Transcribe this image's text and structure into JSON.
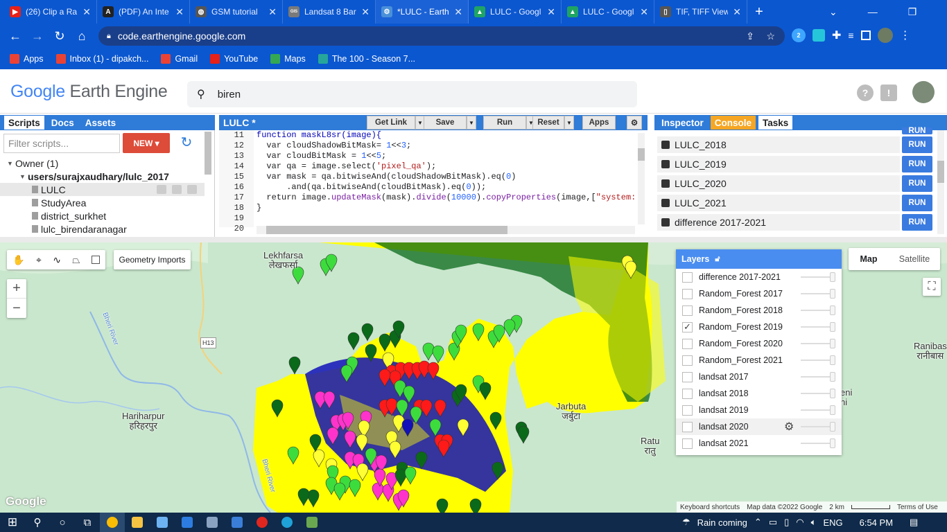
{
  "browser": {
    "tabs": [
      {
        "label": "(26) Clip a Ra",
        "color": "#e62117",
        "glyph": "▶"
      },
      {
        "label": "(PDF) An Inte",
        "color": "#222222",
        "glyph": "A"
      },
      {
        "label": "GSM tutorial",
        "color": "#555555",
        "glyph": "◍"
      },
      {
        "label": "Landsat 8 Bar",
        "color": "#7a7a7a",
        "glyph": "GIS"
      },
      {
        "label": "*LULC - Earth",
        "color": "#4a90d9",
        "glyph": "⚙",
        "active": true
      },
      {
        "label": "LULC - Googl",
        "color": "#1fa463",
        "glyph": "▲"
      },
      {
        "label": "LULC - Googl",
        "color": "#1fa463",
        "glyph": "▲"
      },
      {
        "label": "TIF, TIFF View",
        "color": "#555555",
        "glyph": "▯"
      }
    ],
    "url": "code.earthengine.google.com",
    "bookmarks": [
      {
        "label": "Apps",
        "color": "#ea4335"
      },
      {
        "label": "Inbox (1) - dipakch...",
        "color": "#ea4335"
      },
      {
        "label": "Gmail",
        "color": "#ea4335"
      },
      {
        "label": "YouTube",
        "color": "#e62117"
      },
      {
        "label": "Maps",
        "color": "#34a853"
      },
      {
        "label": "The 100 - Season 7...",
        "color": "#26a69a"
      }
    ],
    "ext_badge": "2"
  },
  "header": {
    "logo_google": "Google",
    "logo_product": "Earth Engine",
    "search_value": "biren"
  },
  "left_panel": {
    "tabs": [
      "Scripts",
      "Docs",
      "Assets"
    ],
    "filter_placeholder": "Filter scripts...",
    "new_label": "NEW",
    "owner_label": "Owner (1)",
    "repo": "users/surajxaudhary/lulc_2017",
    "files": [
      "LULC",
      "StudyArea",
      "district_surkhet",
      "lulc_birendaranagar"
    ]
  },
  "editor": {
    "title": "LULC *",
    "buttons": {
      "get_link": "Get Link",
      "save": "Save",
      "run": "Run",
      "reset": "Reset",
      "apps": "Apps"
    },
    "line_numbers": [
      "11",
      "12",
      "13",
      "14",
      "15",
      "16",
      "17",
      "18",
      "19",
      "20"
    ],
    "lines": [
      [
        {
          "t": "function maskL8sr(image){",
          "c": "kw"
        }
      ],
      [
        {
          "t": "  var cloudShadowBitMask= ",
          "c": ""
        },
        {
          "t": "1",
          "c": "num"
        },
        {
          "t": "<<",
          "c": ""
        },
        {
          "t": "3",
          "c": "num"
        },
        {
          "t": ";",
          "c": ""
        }
      ],
      [
        {
          "t": "  var cloudBitMask = ",
          "c": ""
        },
        {
          "t": "1",
          "c": "num"
        },
        {
          "t": "<<",
          "c": ""
        },
        {
          "t": "5",
          "c": "num"
        },
        {
          "t": ";",
          "c": ""
        }
      ],
      [
        {
          "t": "  var qa = image.select(",
          "c": ""
        },
        {
          "t": "'pixel_qa'",
          "c": "str"
        },
        {
          "t": ");",
          "c": ""
        }
      ],
      [
        {
          "t": "  var mask = qa.bitwiseAnd(cloudShadowBitMask).eq(",
          "c": ""
        },
        {
          "t": "0",
          "c": "num"
        },
        {
          "t": ")",
          "c": ""
        }
      ],
      [
        {
          "t": "      .and(qa.bitwiseAnd(cloudBitMask).eq(",
          "c": ""
        },
        {
          "t": "0",
          "c": "num"
        },
        {
          "t": "));",
          "c": ""
        }
      ],
      [
        {
          "t": "  return image.",
          "c": ""
        },
        {
          "t": "updateMask",
          "c": "fn"
        },
        {
          "t": "(mask).",
          "c": ""
        },
        {
          "t": "divide",
          "c": "fn"
        },
        {
          "t": "(",
          "c": ""
        },
        {
          "t": "10000",
          "c": "num"
        },
        {
          "t": ").",
          "c": ""
        },
        {
          "t": "copyProperties",
          "c": "fn"
        },
        {
          "t": "(image,[",
          "c": ""
        },
        {
          "t": "\"system:t",
          "c": "str"
        }
      ],
      [
        {
          "t": "}",
          "c": ""
        }
      ],
      [
        {
          "t": "",
          "c": ""
        }
      ],
      [
        {
          "t": "",
          "c": ""
        }
      ]
    ]
  },
  "right_panel": {
    "tabs": [
      "Inspector",
      "Console",
      "Tasks"
    ],
    "tasks": [
      "LULC_2018",
      "LULC_2019",
      "LULC_2020",
      "LULC_2021",
      "difference 2017-2021"
    ],
    "run_label": "RUN"
  },
  "map": {
    "geometry_imports": "Geometry Imports",
    "zoom_in": "+",
    "zoom_out": "−",
    "map_type": [
      "Map",
      "Satellite"
    ],
    "layers_title": "Layers",
    "layers": [
      {
        "name": "difference 2017-2021",
        "checked": false
      },
      {
        "name": "Random_Forest 2017",
        "checked": false
      },
      {
        "name": "Random_Forest 2018",
        "checked": false
      },
      {
        "name": "Random_Forest 2019",
        "checked": true
      },
      {
        "name": "Random_Forest 2020",
        "checked": false
      },
      {
        "name": "Random_Forest 2021",
        "checked": false
      },
      {
        "name": "landsat 2017",
        "checked": false
      },
      {
        "name": "landsat 2018",
        "checked": false
      },
      {
        "name": "landsat 2019",
        "checked": false
      },
      {
        "name": "landsat 2020",
        "checked": false
      },
      {
        "name": "landsat 2021",
        "checked": false
      }
    ],
    "places": [
      "Lekhfarsa",
      "लेखफर्सा",
      "Hariharpur",
      "हरिहरपुर",
      "Jarbuta",
      "जर्बुटा",
      "Ratu",
      "रातु",
      "Ranibas",
      "रानीबास",
      "Bheri River",
      "H13",
      "eni",
      "ni"
    ],
    "attribution": {
      "shortcuts": "Keyboard shortcuts",
      "data": "Map data ©2022 Google",
      "scale": "2 km",
      "terms": "Terms of Use"
    },
    "google_mark": "Google"
  },
  "taskbar": {
    "weather": "Rain coming",
    "lang": "ENG",
    "time": "6:54 PM"
  }
}
